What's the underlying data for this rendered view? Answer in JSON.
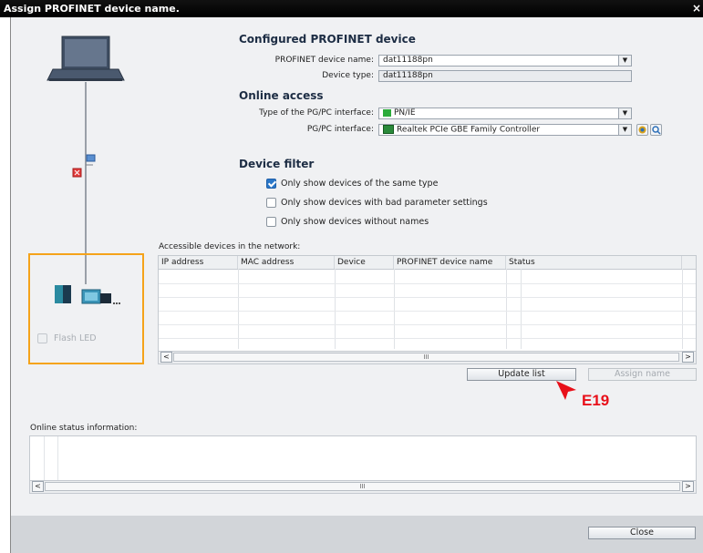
{
  "window": {
    "title": "Assign PROFINET device name.",
    "close_glyph": "×"
  },
  "configured": {
    "heading": "Configured PROFINET device",
    "name_label": "PROFINET device name:",
    "name_value": "dat11188pn",
    "type_label": "Device type:",
    "type_value": "dat11188pn"
  },
  "online": {
    "heading": "Online access",
    "iface_type_label": "Type of the PG/PC interface:",
    "iface_type_value": "PN/IE",
    "iface_label": "PG/PC interface:",
    "iface_value": "Realtek PCIe GBE Family Controller"
  },
  "filter": {
    "heading": "Device filter",
    "options": [
      {
        "label": "Only show devices of the same type",
        "checked": true
      },
      {
        "label": "Only show devices with bad parameter settings",
        "checked": false
      },
      {
        "label": "Only show devices without names",
        "checked": false
      }
    ]
  },
  "devices": {
    "label": "Accessible devices in the network:",
    "columns": [
      "IP address",
      "MAC address",
      "Device",
      "PROFINET device name",
      "Status"
    ],
    "rows": []
  },
  "buttons": {
    "update": "Update list",
    "assign": "Assign name",
    "close": "Close"
  },
  "flash_led": "Flash LED",
  "status": {
    "label": "Online status information:"
  },
  "annotation": {
    "text": "E19",
    "color": "#e8101a"
  },
  "scroll": {
    "thumb_glyph": "III",
    "left": "<",
    "right": ">"
  },
  "colors": {
    "orange": "#f5a31a",
    "titlebar": "#000000"
  }
}
